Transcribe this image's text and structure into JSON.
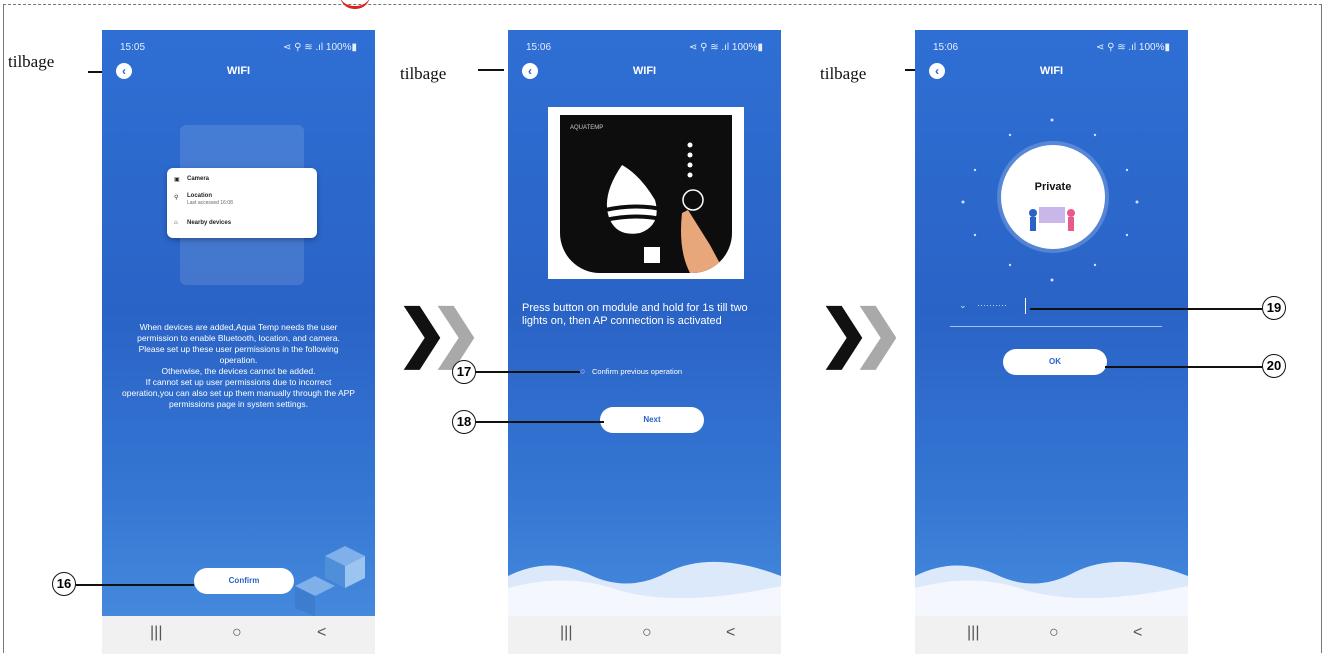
{
  "back_label": "tilbage",
  "phones": [
    {
      "time": "15:05",
      "status_icons": "⋖ ⚲ ≋ .ıl 100%▮",
      "title": "WIFI",
      "permissions": [
        "Camera",
        "Location",
        "Last accessed 16:08",
        "Nearby devices"
      ],
      "body": "When devices are added,Aqua Temp needs the user permission to enable Bluetooth, location, and camera.\nPlease set up these user permissions in the following operation.\nOtherwise, the devices cannot be added.\nIf cannot set up user permissions due to incorrect operation,you can also set up them manually through the APP permissions page in system settings.",
      "button": "Confirm",
      "callout": "16"
    },
    {
      "time": "15:06",
      "status_icons": "⋖ ⚲ ≋ .ıl 100%▮",
      "title": "WIFI",
      "module_brand": "AQUATEMP",
      "body": "Press button on module and hold for 1s till two lights on, then AP connection is activated",
      "checkbox_label": "Confirm previous operation",
      "button": "Next",
      "callouts": [
        "17",
        "18"
      ]
    },
    {
      "time": "15:06",
      "status_icons": "⋖ ⚲ ≋ .ıl 100%▮",
      "title": "WIFI",
      "badge": "Private",
      "password_placeholder": "··········",
      "button": "OK",
      "callouts": [
        "19",
        "20"
      ]
    }
  ],
  "nav_icons": [
    "|||",
    "○",
    "<"
  ],
  "colors": {
    "accent": "#2a63c6",
    "arrow_dark": "#111111",
    "arrow_light": "#a9a9a9"
  }
}
